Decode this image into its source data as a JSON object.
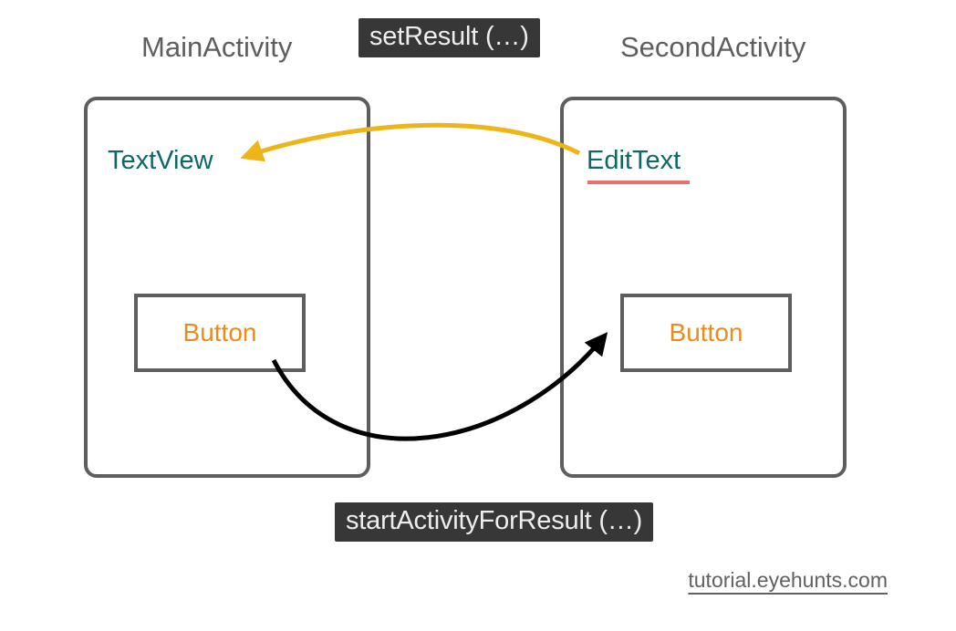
{
  "labels": {
    "main_activity": "MainActivity",
    "second_activity": "SecondActivity",
    "set_result": "setResult (…)",
    "start_activity_for_result": "startActivityForResult (…)"
  },
  "components": {
    "textview": "TextView",
    "edittext": "EditText",
    "button_left": "Button",
    "button_right": "Button"
  },
  "attribution": "tutorial.eyehunts.com",
  "colors": {
    "box_border": "#5e5e5e",
    "label_gray": "#5e5e5e",
    "chip_bg": "#373737",
    "chip_fg": "#eeeeee",
    "teal": "#0c6965",
    "orange": "#e98c1b",
    "red_underline": "#ec6f6f",
    "arrow_yellow": "#edb518",
    "arrow_black": "#000000"
  },
  "diagram": {
    "description": "Android activity communication diagram showing MainActivity with TextView and Button, SecondActivity with EditText and Button. Black arrow from left Button to right Button labeled startActivityForResult. Yellow arrow from EditText back to TextView labeled setResult.",
    "arrows": [
      {
        "from": "MainActivity.Button",
        "to": "SecondActivity.Button",
        "color": "black",
        "label": "startActivityForResult (…)"
      },
      {
        "from": "SecondActivity.EditText",
        "to": "MainActivity.TextView",
        "color": "yellow",
        "label": "setResult (…)"
      }
    ]
  }
}
